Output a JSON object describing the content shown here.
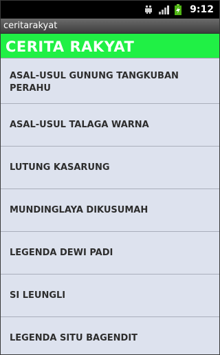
{
  "status_bar": {
    "time": "9:12",
    "icons": [
      "usb-debug-icon",
      "signal-icon",
      "battery-charging-icon"
    ]
  },
  "app": {
    "window_title": "ceritarakyat",
    "header_title": "CERITA RAKYAT",
    "header_color": "#20f045"
  },
  "stories": [
    {
      "label": "ASAL-USUL GUNUNG TANGKUBAN PERAHU"
    },
    {
      "label": "ASAL-USUL TALAGA WARNA"
    },
    {
      "label": "LUTUNG KASARUNG"
    },
    {
      "label": "MUNDINGLAYA DIKUSUMAH"
    },
    {
      "label": "LEGENDA DEWI PADI"
    },
    {
      "label": "SI LEUNGLI"
    },
    {
      "label": "LEGENDA SITU BAGENDIT"
    }
  ]
}
